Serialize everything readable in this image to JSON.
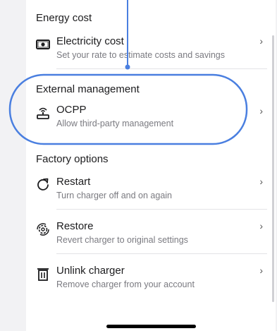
{
  "energy": {
    "header": "Energy cost",
    "item": {
      "title": "Electricity cost",
      "subtitle": "Set your rate to estimate costs and savings",
      "icon": "banknote-icon"
    }
  },
  "external": {
    "header": "External management",
    "item": {
      "title": "OCPP",
      "subtitle": "Allow third-party management",
      "icon": "antenna-icon"
    }
  },
  "factory": {
    "header": "Factory options",
    "items": [
      {
        "title": "Restart",
        "subtitle": "Turn charger off and on again",
        "icon": "restart-icon"
      },
      {
        "title": "Restore",
        "subtitle": "Revert charger to original settings",
        "icon": "restore-icon"
      },
      {
        "title": "Unlink charger",
        "subtitle": "Remove charger from your account",
        "icon": "trash-icon"
      }
    ]
  },
  "chevron": "›",
  "colors": {
    "highlight": "#4a7fe0",
    "text": "#1c1c1e",
    "secondary": "#7a7a80"
  }
}
